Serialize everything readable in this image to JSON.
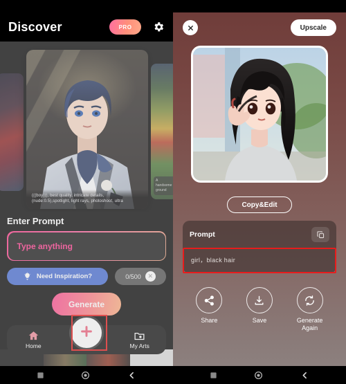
{
  "left": {
    "header": {
      "title": "Discover",
      "pro_label": "PRO",
      "settings_icon": "gear-icon"
    },
    "carousel": {
      "main_caption": "(((boy))), best quality, intricate details, (nude:0.5),spotlight, light rays, photoshoot, ultra",
      "right_caption": "A handsome ground"
    },
    "prompt": {
      "section_label": "Enter Prompt",
      "input_placeholder": "Type anything",
      "input_value": "",
      "inspiration_label": "Need Inspiration?",
      "counter": "0/500",
      "clear_icon": "close-icon",
      "generate_label": "Generate"
    },
    "nav": {
      "home_label": "Home",
      "home_icon": "home-icon",
      "create_icon": "plus-icon",
      "myarts_label": "My Arts",
      "myarts_icon": "folder-image-icon"
    }
  },
  "right": {
    "header": {
      "close_icon": "close-icon",
      "upscale_label": "Upscale"
    },
    "copy_edit_label": "Copy&Edit",
    "prompt_card": {
      "title": "Prompt",
      "copy_icon": "copy-icon",
      "text": "girl，black hair"
    },
    "actions": [
      {
        "label": "Share",
        "icon": "share-icon"
      },
      {
        "label": "Save",
        "icon": "download-icon"
      },
      {
        "label": "Generate\nAgain",
        "line1": "Generate",
        "line2": "Again",
        "icon": "refresh-icon"
      }
    ]
  },
  "system_bar": {
    "recents_icon": "square-icon",
    "home_icon": "circle-icon",
    "back_icon": "chevron-left-icon"
  },
  "colors": {
    "accent_pink": "#ff3b8e",
    "accent_orange": "#ffb182",
    "highlight_red": "#e81c1c",
    "inspiration_blue": "#4a6fd4",
    "right_bg_top": "#6e3b38"
  }
}
